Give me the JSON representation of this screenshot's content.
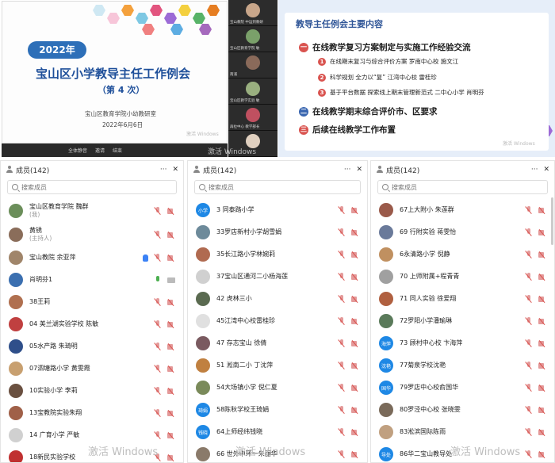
{
  "slide_left": {
    "year": "2022年",
    "title": "宝山区小学教导主任工作例会",
    "session": "（第 4 次）",
    "org": "宝山区教育学院小幼教研室",
    "date": "2022年6月6日",
    "watermark": "激活 Windows"
  },
  "meeting_bar": {
    "items": [
      "全体静音",
      "邀请",
      "结束"
    ]
  },
  "video_tiles": [
    {
      "label": "宝山教院  中运到教研"
    },
    {
      "label": "宝山区教育学院  敏"
    },
    {
      "label": "南浦"
    },
    {
      "label": "宝山区教学实验  敏"
    },
    {
      "label": "再拉中心  教学部长"
    },
    {
      "label": ""
    }
  ],
  "slide_right": {
    "title": "教导主任例会主要内容",
    "items": [
      {
        "num": "一",
        "text": "在线教学复习方案制定与实施工作经验交流",
        "color": "#d9534f"
      },
      {
        "num": "二",
        "text": "在线教学期末综合评价市、区要求",
        "color": "#3a66b0"
      },
      {
        "num": "三",
        "text": "后续在线教学工作布置",
        "color": "#d9534f"
      }
    ],
    "subitems": [
      {
        "num": "1",
        "text": "在线期末复习与综合评价方案   罗南中心校   施文江"
      },
      {
        "num": "2",
        "text": "科学规划  全力以“复”  江湾中心校   雷桂珍"
      },
      {
        "num": "3",
        "text": "基于平台数据  探索线上期末管理新范式   二中心小学   肖明芬"
      }
    ],
    "watermark": "激活 Windows"
  },
  "panels": [
    {
      "title": "成员(142)",
      "search_placeholder": "搜索成员",
      "members": [
        {
          "name": "宝山区教育学院 魏群",
          "role": "(我)",
          "avatar": "#6b8e5a",
          "hand": false,
          "mic": "off"
        },
        {
          "name": "黄锈",
          "role": "(主持人)",
          "avatar": "#8a6d5a",
          "hand": false,
          "mic": "off"
        },
        {
          "name": "宝山教院  余亚萍",
          "role": "",
          "avatar": "#a0856a",
          "hand": true,
          "mic": "off"
        },
        {
          "name": "肖明芬1",
          "role": "",
          "avatar": "#3b6fb0",
          "hand": false,
          "mic": "on"
        },
        {
          "name": "38王莉",
          "role": "",
          "avatar": "#b07050",
          "hand": false,
          "mic": "off"
        },
        {
          "name": "04 美兰湖实验学校 陈敏",
          "role": "",
          "avatar": "#c04040",
          "hand": false,
          "mic": "off"
        },
        {
          "name": "05水产路   朱琦明",
          "role": "",
          "avatar": "#2f4f8a",
          "hand": false,
          "mic": "off"
        },
        {
          "name": "07泗塘路小学 黄雯霞",
          "role": "",
          "avatar": "#c8a070",
          "hand": false,
          "mic": "off"
        },
        {
          "name": "10实验小学 李莉",
          "role": "",
          "avatar": "#6a5040",
          "hand": false,
          "mic": "off"
        },
        {
          "name": "13宝教院实验朱翔",
          "role": "",
          "avatar": "#a06048",
          "hand": false,
          "mic": "off"
        },
        {
          "name": "14 广育小学 严敏",
          "role": "",
          "avatar": "#d0d0d0",
          "hand": false,
          "mic": "off"
        },
        {
          "name": "18新民实验学校",
          "role": "",
          "avatar": "#c03030",
          "hand": false,
          "mic": "off"
        }
      ]
    },
    {
      "title": "成员(142)",
      "search_placeholder": "搜索成员",
      "members": [
        {
          "name": "3 同泰路小学",
          "role": "",
          "avatar": "#1e88e5",
          "avatar_text": "小学",
          "hand": false,
          "mic": "off"
        },
        {
          "name": "33罗店新村小学胡雪娟",
          "role": "",
          "avatar": "#6d8a9a",
          "hand": false,
          "mic": "off"
        },
        {
          "name": "35长江路小学林婉莉",
          "role": "",
          "avatar": "#b06a50",
          "hand": false,
          "mic": "off"
        },
        {
          "name": "37宝山区通河二小杨海莲",
          "role": "",
          "avatar": "#d0d0d0",
          "hand": false,
          "mic": "off"
        },
        {
          "name": "42  虎林三小",
          "role": "",
          "avatar": "#5a6a50",
          "hand": false,
          "mic": "off"
        },
        {
          "name": "45江湾中心校雷桂珍",
          "role": "",
          "avatar": "#e0e0e0",
          "hand": false,
          "mic": "off"
        },
        {
          "name": "47 存志宝山 徐倩",
          "role": "",
          "avatar": "#7a5a60",
          "hand": false,
          "mic": "off"
        },
        {
          "name": "51  淞南二小 丁沈萍",
          "role": "",
          "avatar": "#c08040",
          "hand": false,
          "mic": "off"
        },
        {
          "name": "54大场镇小学 倪仁夏",
          "role": "",
          "avatar": "#7a8a5a",
          "hand": false,
          "mic": "off"
        },
        {
          "name": "58陈秋学校王琦娟",
          "role": "",
          "avatar": "#1e88e5",
          "avatar_text": "琦娟",
          "hand": false,
          "mic": "off"
        },
        {
          "name": "64上师经纬钱晓",
          "role": "",
          "avatar": "#1e88e5",
          "avatar_text": "钱晓",
          "hand": false,
          "mic": "off"
        },
        {
          "name": "66 世外中环一朱丽华",
          "role": "",
          "avatar": "#8a7a6a",
          "hand": false,
          "mic": "off"
        }
      ]
    },
    {
      "title": "成员(142)",
      "search_placeholder": "搜索成员",
      "members": [
        {
          "name": "67上大附小 朱莲群",
          "role": "",
          "avatar": "#9a5a4a",
          "hand": false,
          "mic": "off"
        },
        {
          "name": "69  行附实验 蒋雯怡",
          "role": "",
          "avatar": "#6a7a9a",
          "hand": false,
          "mic": "off"
        },
        {
          "name": "6永清路小学 倪静",
          "role": "",
          "avatar": "#c09060",
          "hand": false,
          "mic": "off"
        },
        {
          "name": "70 上师附属+程青青",
          "role": "",
          "avatar": "#a0a0a0",
          "hand": false,
          "mic": "off"
        },
        {
          "name": "71 同人实验 徐爱翔",
          "role": "",
          "avatar": "#b06040",
          "hand": false,
          "mic": "off"
        },
        {
          "name": "72罗阳小学潘瑜琳",
          "role": "",
          "avatar": "#5a7a5a",
          "hand": false,
          "mic": "off"
        },
        {
          "name": "73 顾村中心校 卞海萍",
          "role": "",
          "avatar": "#1e88e5",
          "avatar_text": "海萍",
          "hand": false,
          "mic": "off"
        },
        {
          "name": "77菊泉学校沈艳",
          "role": "",
          "avatar": "#1e88e5",
          "avatar_text": "沈艳",
          "hand": false,
          "mic": "off"
        },
        {
          "name": "79罗店中心校俞国华",
          "role": "",
          "avatar": "#1e88e5",
          "avatar_text": "国华",
          "hand": false,
          "mic": "off"
        },
        {
          "name": "80罗泾中心校 张晓雯",
          "role": "",
          "avatar": "#7a6a5a",
          "hand": false,
          "mic": "off"
        },
        {
          "name": "83淞滨国际陈雨",
          "role": "",
          "avatar": "#c0a080",
          "hand": false,
          "mic": "off"
        },
        {
          "name": "86华二宝山教导处",
          "role": "",
          "avatar": "#1e88e5",
          "avatar_text": "导处",
          "hand": false,
          "mic": "off"
        }
      ]
    }
  ],
  "watermark": "激活 Windows",
  "colors": {
    "accent": "#2d6fb8",
    "mute_red": "#d9534f"
  }
}
